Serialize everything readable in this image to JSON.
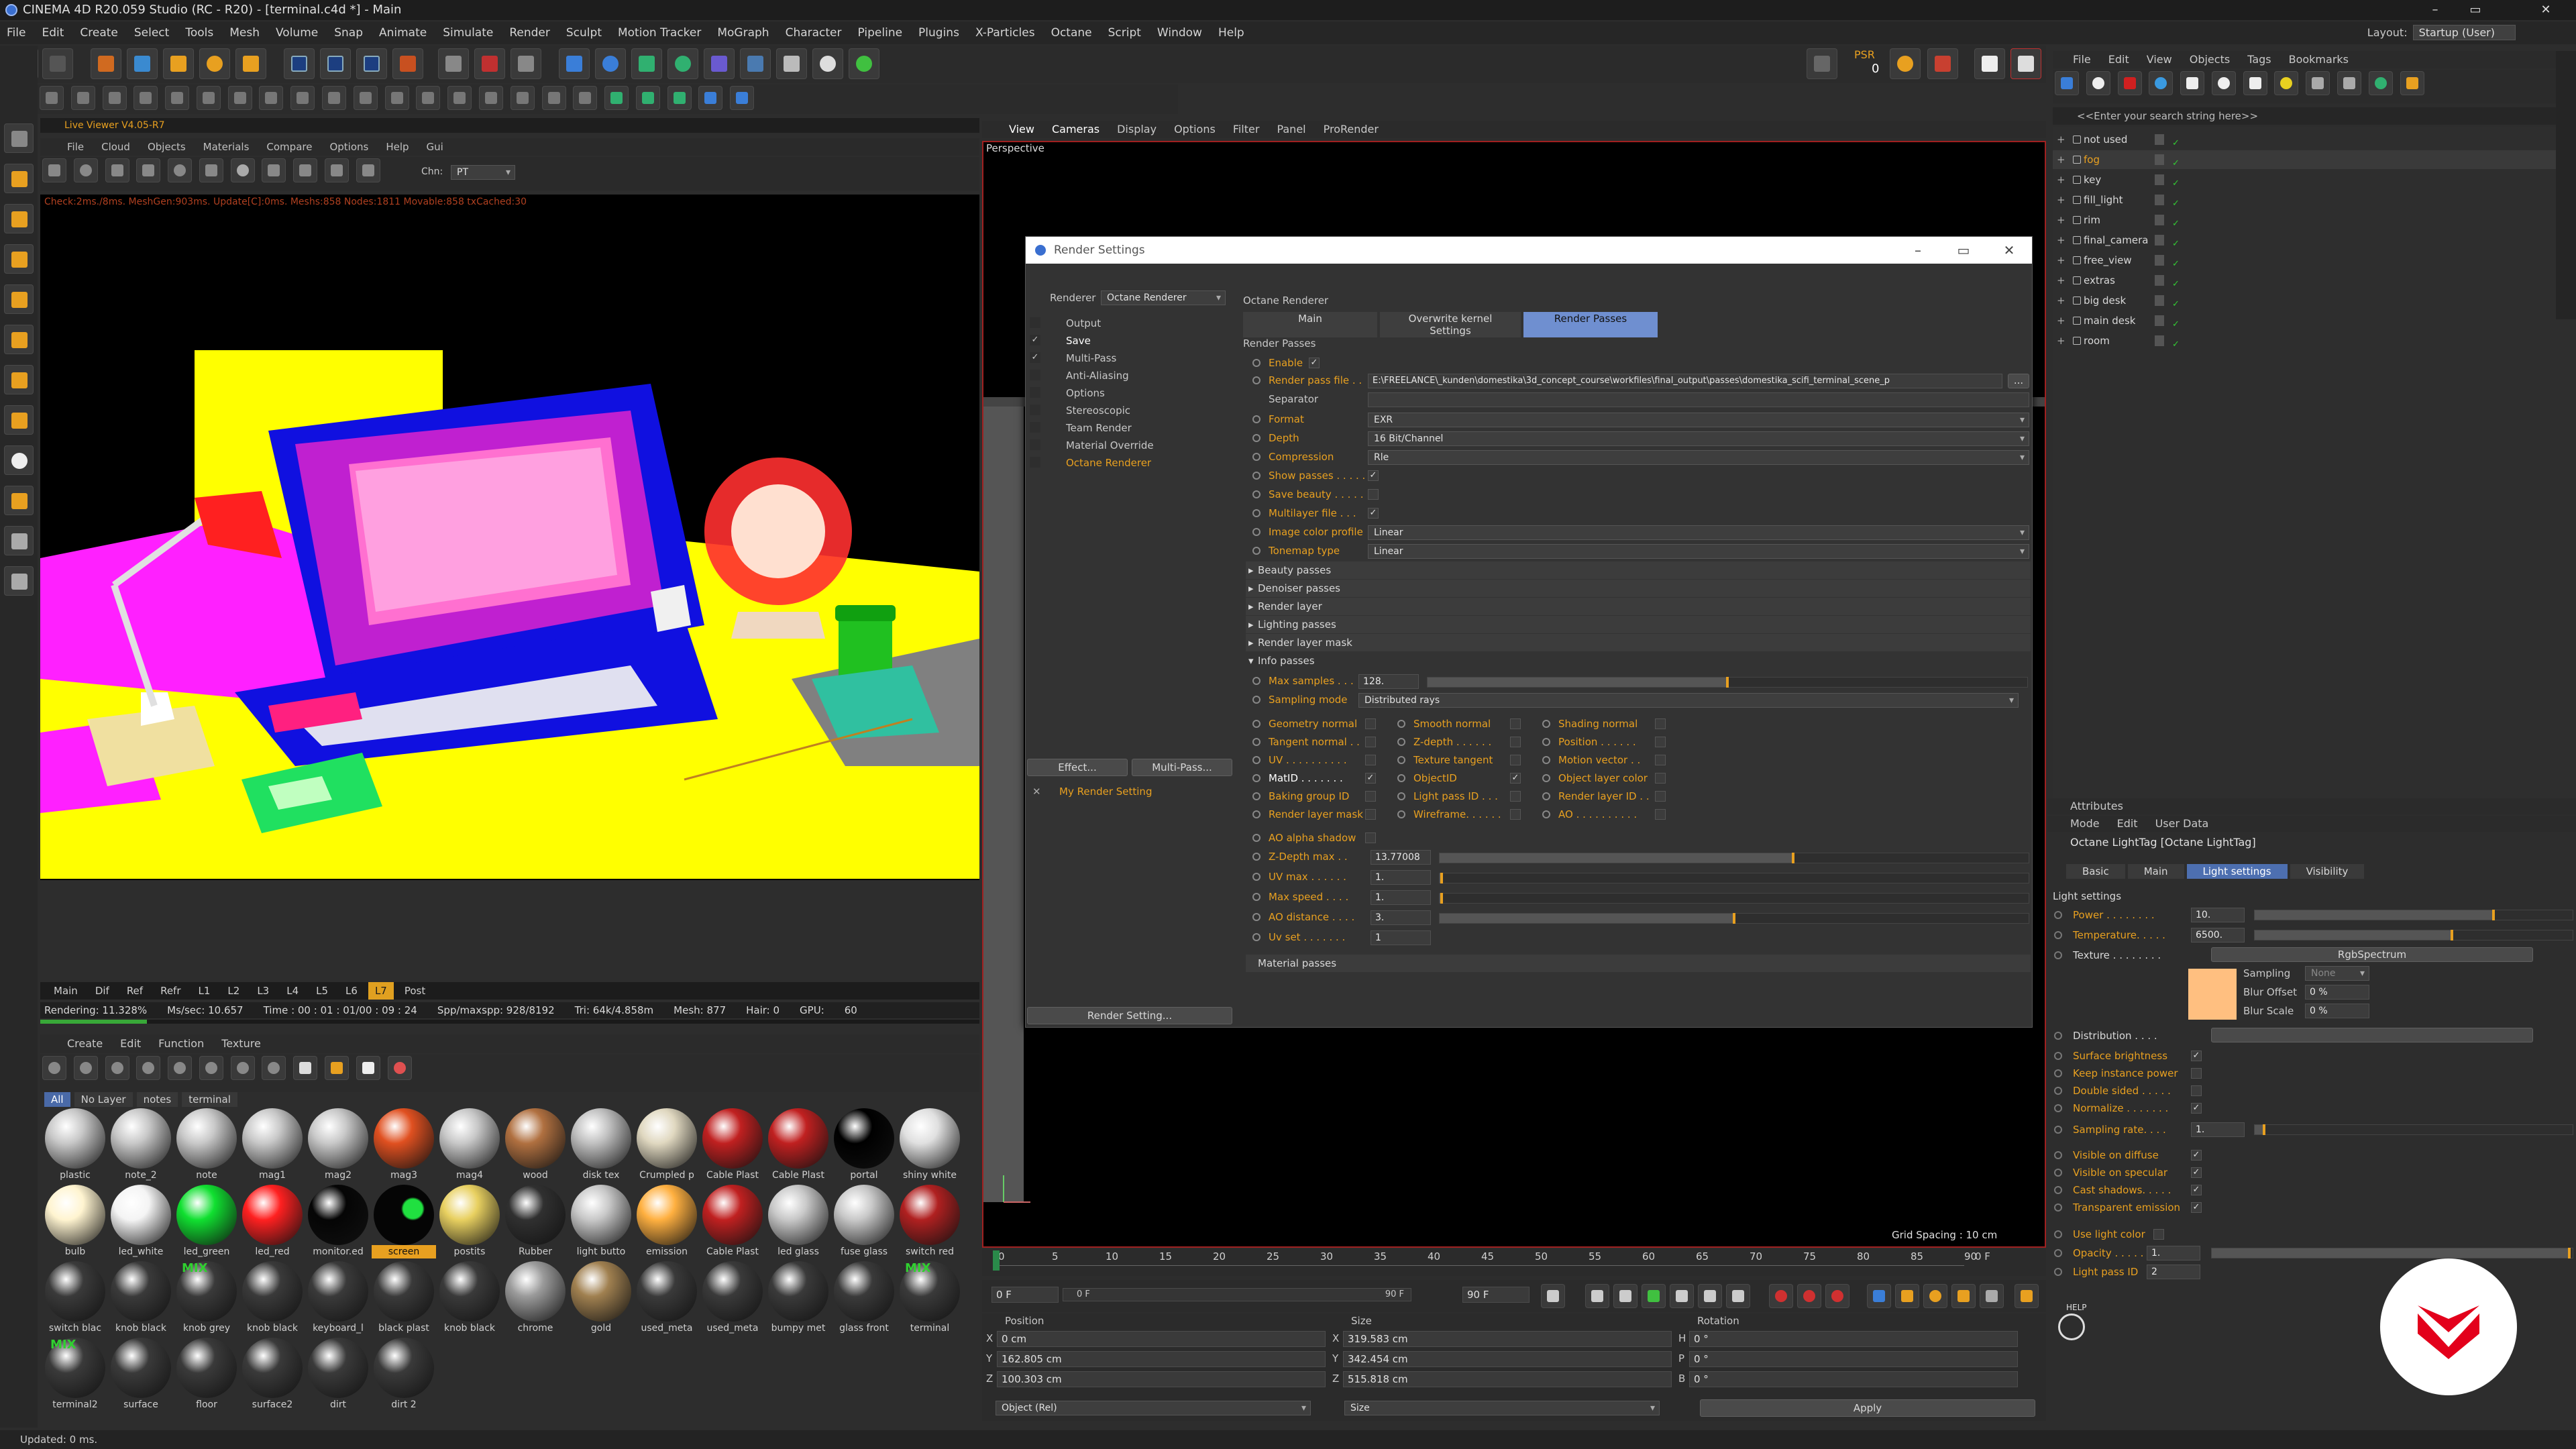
{
  "window": {
    "title": "CINEMA 4D R20.059 Studio (RC - R20) - [terminal.c4d *] - Main",
    "min": "–",
    "max": "▭",
    "close": "✕"
  },
  "menu": [
    "File",
    "Edit",
    "Create",
    "Select",
    "Tools",
    "Mesh",
    "Volume",
    "Snap",
    "Animate",
    "Simulate",
    "Render",
    "Sculpt",
    "Motion Tracker",
    "MoGraph",
    "Character",
    "Pipeline",
    "Plugins",
    "X-Particles",
    "Octane",
    "Script",
    "Window",
    "Help"
  ],
  "layout": {
    "label": "Layout:",
    "value": "Startup (User)"
  },
  "psr": {
    "label": "PSR",
    "value": "0"
  },
  "live_viewer": {
    "title": "Live Viewer V4.05-R7",
    "menu": [
      "File",
      "Cloud",
      "Objects",
      "Materials",
      "Compare",
      "Options",
      "Help",
      "Gui"
    ],
    "chn_label": "Chn:",
    "chn_value": "PT",
    "info": "Check:2ms./8ms. MeshGen:903ms. Update[C]:0ms. Meshs:858 Nodes:1811 Movable:858 txCached:30",
    "tabs": [
      "Main",
      "Dif",
      "Ref",
      "Refr",
      "L1",
      "L2",
      "L3",
      "L4",
      "L5",
      "L6",
      "L7",
      "Post"
    ],
    "active_tab": "L7",
    "stats": [
      "Rendering: 11.328%",
      "Ms/sec: 10.657",
      "Time : 00 : 01 : 01/00 : 09 : 24",
      "Spp/maxspp: 928/8192",
      "Tri: 64k/4.858m",
      "Mesh: 877",
      "Hair: 0",
      "GPU:",
      "60"
    ]
  },
  "materials": {
    "menu": [
      "Create",
      "Edit",
      "Function",
      "Texture"
    ],
    "filters": [
      "All",
      "No Layer",
      "notes",
      "terminal"
    ],
    "items": [
      "plastic",
      "note_2",
      "note",
      "mag1",
      "mag2",
      "mag3",
      "mag4",
      "wood",
      "disk tex",
      "Crumpled p",
      "Cable Plast",
      "Cable Plast",
      "portal",
      "shiny white",
      "bulb",
      "led_white",
      "led_green",
      "led_red",
      "monitor.ed",
      "screen",
      "postits",
      "Rubber",
      "light butto",
      "emission",
      "Cable Plast",
      "led glass",
      "fuse glass",
      "switch red",
      "switch blac",
      "knob black",
      "knob grey",
      "knob black",
      "keyboard_l",
      "black plast",
      "knob black",
      "chrome",
      "gold",
      "used_meta",
      "used_meta",
      "bumpy met",
      "glass front",
      "terminal",
      "terminal2",
      "surface",
      "floor",
      "surface2",
      "dirt",
      "dirt 2"
    ],
    "active": "screen",
    "mix_label": "MIX"
  },
  "viewport": {
    "menu": [
      "View",
      "Cameras",
      "Display",
      "Options",
      "Filter",
      "Panel",
      "ProRender"
    ],
    "label": "Perspective",
    "grid_spacing": "Grid Spacing : 10 cm"
  },
  "timeline": {
    "ticks": [
      "0",
      "5",
      "10",
      "15",
      "20",
      "25",
      "30",
      "35",
      "40",
      "45",
      "50",
      "55",
      "60",
      "65",
      "70",
      "75",
      "80",
      "85",
      "90"
    ],
    "end": "0 F",
    "start_field": "0 F",
    "cur_field": "0 F",
    "end_field": "90 F",
    "end_field2": "90 F"
  },
  "coords": {
    "headers": [
      "Position",
      "Size",
      "Rotation"
    ],
    "pos": [
      {
        "axis": "X",
        "val": "0 cm"
      },
      {
        "axis": "Y",
        "val": "162.805 cm"
      },
      {
        "axis": "Z",
        "val": "100.303 cm"
      }
    ],
    "size": [
      {
        "axis": "X",
        "val": "319.583 cm"
      },
      {
        "axis": "Y",
        "val": "342.454 cm"
      },
      {
        "axis": "Z",
        "val": "515.818 cm"
      }
    ],
    "rot": [
      {
        "axis": "H",
        "val": "0 °"
      },
      {
        "axis": "P",
        "val": "0 °"
      },
      {
        "axis": "B",
        "val": "0 °"
      }
    ],
    "mode1": "Object (Rel)",
    "mode2": "Size",
    "apply": "Apply"
  },
  "objects": {
    "menu": [
      "File",
      "Edit",
      "View",
      "Objects",
      "Tags",
      "Bookmarks"
    ],
    "search": "<<Enter your search string here>>",
    "items": [
      {
        "name": "not used",
        "color": "#d8d8d8"
      },
      {
        "name": "fog",
        "color": "#e8a020"
      },
      {
        "name": "key",
        "color": "#d8d8d8"
      },
      {
        "name": "fill_light",
        "color": "#d8d8d8"
      },
      {
        "name": "rim",
        "color": "#d8d8d8"
      },
      {
        "name": "final_camera",
        "color": "#d8d8d8"
      },
      {
        "name": "free_view",
        "color": "#d8d8d8"
      },
      {
        "name": "extras",
        "color": "#d8d8d8"
      },
      {
        "name": "big desk",
        "color": "#d8d8d8"
      },
      {
        "name": "main desk",
        "color": "#d8d8d8"
      },
      {
        "name": "room",
        "color": "#d8d8d8"
      }
    ]
  },
  "attributes": {
    "header": "Attributes",
    "menu": [
      "Mode",
      "Edit",
      "User Data"
    ],
    "title": "Octane LightTag [Octane LightTag]",
    "tabs": [
      "Basic",
      "Main",
      "Light settings",
      "Visibility"
    ],
    "active_tab": "Light settings",
    "section": "Light settings",
    "power_label": "Power . . . . . . . .",
    "power": "10.",
    "power_level": 0.75,
    "temp_label": "Temperature. . . . .",
    "temp": "6500.",
    "temp_level": 0.62,
    "texture_label": "Texture . . . . . . . .",
    "texture_value": "RgbSpectrum",
    "sampling_label": "Sampling",
    "sampling": "None",
    "blur_offset_label": "Blur Offset",
    "blur_offset": "0 %",
    "blur_scale_label": "Blur Scale",
    "blur_scale": "0 %",
    "distribution_label": "Distribution . . . .",
    "checks": [
      {
        "label": "Surface brightness",
        "on": true
      },
      {
        "label": "Keep instance power",
        "on": false
      },
      {
        "label": "Double sided . . . . .",
        "on": false
      },
      {
        "label": "Normalize . . . . . . .",
        "on": true
      }
    ],
    "sampling_rate_label": "Sampling rate. . . .",
    "sampling_rate": "1.",
    "vis": [
      {
        "label": "Visible on diffuse",
        "on": true
      },
      {
        "label": "Visible on specular",
        "on": true
      },
      {
        "label": "Cast shadows. . . . .",
        "on": true
      },
      {
        "label": "Transparent emission",
        "on": true
      }
    ],
    "use_light_color": "Use light color",
    "opacity_label": "Opacity . . . . . . . .",
    "opacity": "1.",
    "light_pass_label": "Light pass ID",
    "light_pass": "2"
  },
  "render_settings": {
    "title": "Render Settings",
    "renderer_label": "Renderer",
    "renderer": "Octane Renderer",
    "tree": [
      {
        "label": "Output",
        "chk": false,
        "active": false
      },
      {
        "label": "Save",
        "chk": true,
        "active": true
      },
      {
        "label": "Multi-Pass",
        "chk": true,
        "active": false
      },
      {
        "label": "Anti-Aliasing",
        "chk": false,
        "active": false
      },
      {
        "label": "Options",
        "chk": false,
        "active": false
      },
      {
        "label": "Stereoscopic",
        "chk": false,
        "active": false
      },
      {
        "label": "Team Render",
        "chk": false,
        "active": false
      },
      {
        "label": "Material Override",
        "chk": false,
        "active": false
      },
      {
        "label": "Octane Renderer",
        "chk": false,
        "active": true
      }
    ],
    "effect_btn": "Effect...",
    "multipass_btn": "Multi-Pass...",
    "setting_name": "My Render Setting",
    "setting_btn": "Render Setting...",
    "panel_title": "Octane Renderer",
    "tabs": [
      "Main",
      "Overwrite kernel Settings",
      "Render Passes"
    ],
    "active_tab": "Render Passes",
    "section": "Render Passes",
    "enable_label": "Enable",
    "enable": "✓",
    "file_label": "Render pass file . .",
    "file": "E:\\FREELANCE\\_kunden\\domestika\\3d_concept_course\\workfiles\\final_output\\passes\\domestika_scifi_terminal_scene_p",
    "file_btn": "...",
    "separator_label": "Separator",
    "format_label": "Format",
    "format": "EXR",
    "depth_label": "Depth",
    "depth": "16 Bit/Channel",
    "compression_label": "Compression",
    "compression": "Rle",
    "show_passes": "Show passes . . . . .",
    "save_beauty": "Save beauty . . . . .",
    "multilayer": "Multilayer file . . .",
    "icp_label": "Image color profile",
    "icp": "Linear",
    "tonemap_label": "Tonemap type",
    "tonemap": "Linear",
    "groups": [
      "Beauty passes",
      "Denoiser passes",
      "Render layer",
      "Lighting passes",
      "Render layer mask",
      "Info passes"
    ],
    "max_samples_label": "Max samples . . .",
    "max_samples": "128.",
    "max_samples_level": 0.5,
    "sampling_mode_label": "Sampling mode",
    "sampling_mode": "Distributed rays",
    "info_col1": [
      "Geometry normal",
      "Tangent normal . .",
      "UV . . . . . . . . . .",
      "MatID . . . . . . .",
      "Baking group ID",
      "Render layer mask"
    ],
    "info_col2": [
      "Smooth normal",
      "Z-depth . . . . . .",
      "Texture tangent",
      "ObjectID",
      "Light pass ID . . .",
      "Wireframe. . . . . ."
    ],
    "info_col3": [
      "Shading normal",
      "Position . . . . . .",
      "Motion vector . .",
      "Object layer color",
      "Render layer ID . .",
      "AO . . . . . . . . . ."
    ],
    "ao_alpha": "AO alpha shadow",
    "zdepth_label": "Z-Depth max . .",
    "zdepth": "13.77008",
    "zdepth_level": 0.6,
    "uvmax_label": "UV max . . . . . .",
    "uvmax": "1.",
    "uvmax_level": 0.003,
    "maxspeed_label": "Max speed . . . .",
    "maxspeed": "1.",
    "maxspeed_level": 0.003,
    "aodist_label": "AO distance . . . .",
    "aodist": "3.",
    "aodist_level": 0.5,
    "uvset_label": "Uv set . . . . . . .",
    "uvset": "1",
    "material_passes": "Material passes"
  },
  "status": "Updated: 0 ms.",
  "help_label": "HELP",
  "colors": {
    "accent": "#e8a020",
    "active_tab": "#4d6fb0",
    "viewport_border": "#a02020",
    "brand": "#e3001b"
  }
}
